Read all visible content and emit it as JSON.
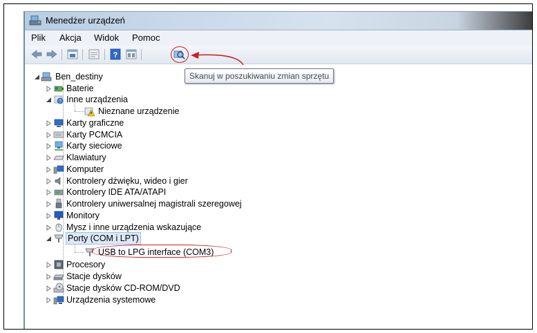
{
  "window": {
    "title": "Menedżer urządzeń"
  },
  "menu": [
    "Plik",
    "Akcja",
    "Widok",
    "Pomoc"
  ],
  "toolbar": {
    "buttons": [
      "back-icon",
      "forward-icon",
      "properties-view-icon",
      "show-hidden-icon",
      "help-icon",
      "device-list-icon",
      "scan-hardware-icon"
    ],
    "tooltip": "Skanuj w poszukiwaniu zmian sprzętu"
  },
  "tree": {
    "root": "Ben_destiny",
    "items": [
      "Baterie",
      "Inne urządzenia",
      "Nieznane urządzenie",
      "Karty graficzne",
      "Karty PCMCIA",
      "Karty sieciowe",
      "Klawiatury",
      "Komputer",
      "Kontrolery dźwięku, wideo i gier",
      "Kontrolery IDE ATA/ATAPI",
      "Kontrolery uniwersalnej magistrali szeregowej",
      "Monitory",
      "Mysz i inne urządzenia wskazujące",
      "Porty (COM i LPT)",
      "USB to LPG interface (COM3)",
      "Procesory",
      "Stacje dysków",
      "Stacje dysków CD-ROM/DVD",
      "Urządzenia systemowe"
    ]
  },
  "colors": {
    "annotation": "#d21c1c",
    "selection": "#dce8f6"
  }
}
